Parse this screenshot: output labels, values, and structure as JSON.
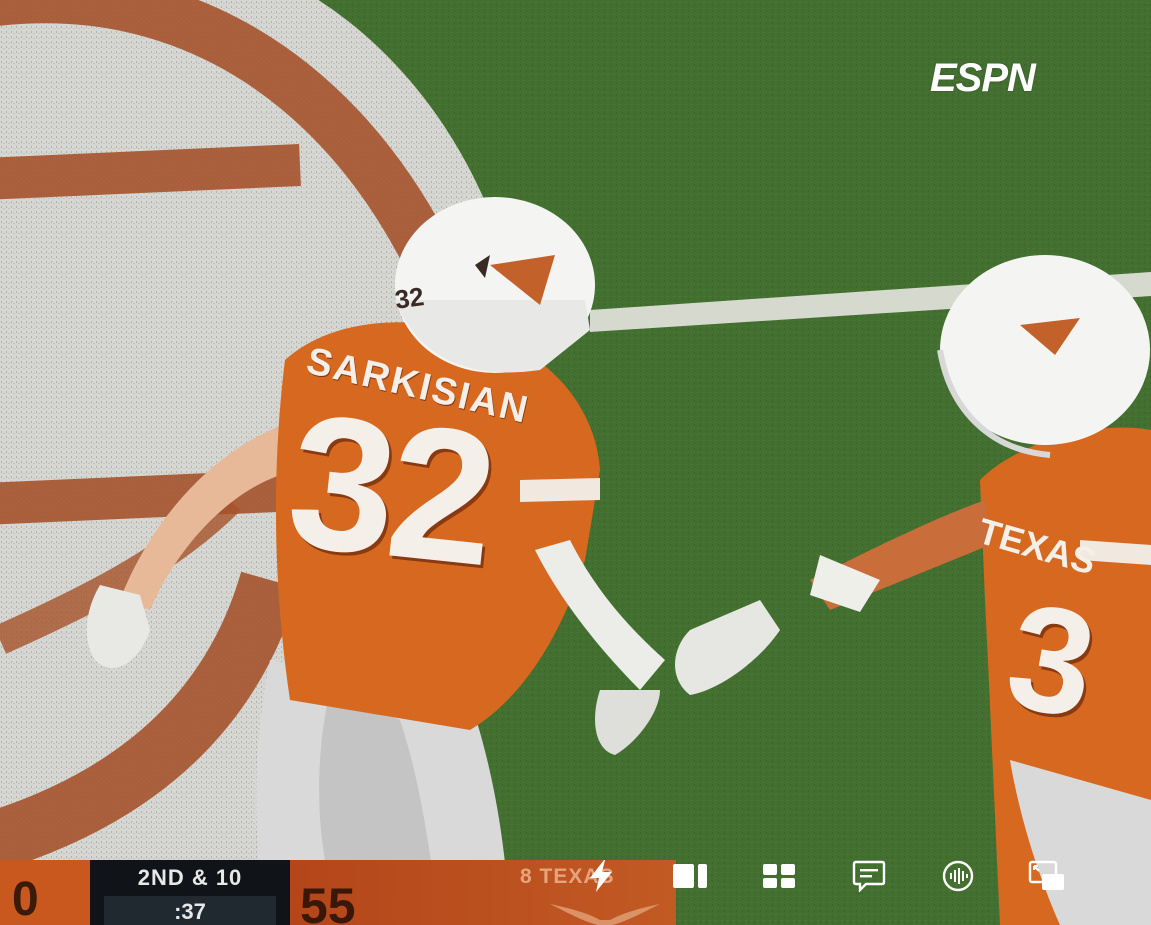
{
  "broadcaster": "ESPN",
  "jersey": {
    "name": "SARKISIAN",
    "number": "32",
    "helmet_number": "32",
    "teammate_text": "TEXAS",
    "teammate_number": "3"
  },
  "scorebug": {
    "away_score": "0",
    "down_distance": "2ND & 10",
    "game_clock": ":37",
    "home_score": "55",
    "home_team": "8 TEXAS"
  },
  "controls": [
    {
      "id": "live",
      "icon": "lightning-icon"
    },
    {
      "id": "split-view",
      "icon": "split-view-icon"
    },
    {
      "id": "multiview",
      "icon": "grid-icon"
    },
    {
      "id": "captions",
      "icon": "captions-icon"
    },
    {
      "id": "audio",
      "icon": "audio-icon"
    },
    {
      "id": "picture-in-picture",
      "icon": "pip-icon"
    }
  ],
  "colors": {
    "burnt_orange": "#c9581f",
    "field_green": "#3f6a2a",
    "scorebug_dark": "#101418"
  }
}
